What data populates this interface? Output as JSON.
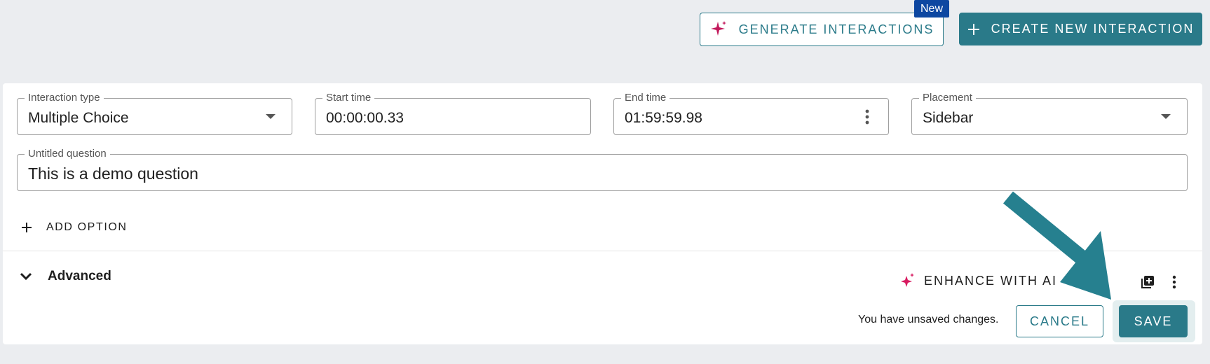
{
  "toolbar": {
    "generate_label": "GENERATE INTERACTIONS",
    "new_badge": "New",
    "create_label": "CREATE NEW INTERACTION"
  },
  "form": {
    "interaction_type": {
      "label": "Interaction type",
      "value": "Multiple Choice"
    },
    "start_time": {
      "label": "Start time",
      "value": "00:00:00.33"
    },
    "end_time": {
      "label": "End time",
      "value": "01:59:59.98"
    },
    "placement": {
      "label": "Placement",
      "value": "Sidebar"
    },
    "question": {
      "label": "Untitled question",
      "value": "This is a demo question"
    },
    "add_option_label": "ADD OPTION"
  },
  "footer": {
    "advanced_label": "Advanced",
    "enhance_label": "ENHANCE WITH AI",
    "unsaved_text": "You have unsaved changes.",
    "cancel_label": "CANCEL",
    "save_label": "SAVE"
  },
  "colors": {
    "accent": "#2a7a89",
    "badge": "#0d47a1",
    "sparkle": "#d81b60",
    "background": "#ebedf0"
  },
  "icons": [
    "sparkle-icon",
    "plus-icon",
    "dropdown-arrow-icon",
    "more-vertical-icon",
    "chevron-down-icon",
    "duplicate-icon",
    "arrow-annotation"
  ]
}
